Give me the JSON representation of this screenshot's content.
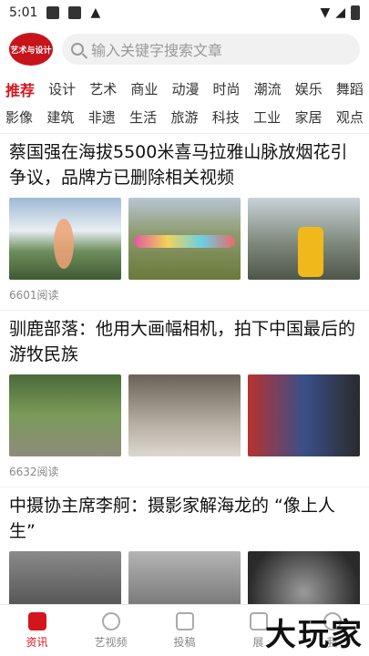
{
  "status": {
    "time": "5:01"
  },
  "header": {
    "logo_text": "艺术与设计",
    "search_placeholder": "输入关键字搜索文章"
  },
  "categories": {
    "row1": [
      "推荐",
      "设计",
      "艺术",
      "商业",
      "动漫",
      "时尚",
      "潮流",
      "娱乐",
      "舞蹈"
    ],
    "row2": [
      "影像",
      "建筑",
      "非遗",
      "生活",
      "旅游",
      "科技",
      "工业",
      "家居",
      "观点"
    ]
  },
  "articles": [
    {
      "title": "蔡国强在海拔5500米喜马拉雅山脉放烟花引争议，品牌方已删除相关视频",
      "reads": "6601阅读"
    },
    {
      "title": "驯鹿部落：他用大画幅相机，拍下中国最后的游牧民族",
      "reads": "6632阅读"
    },
    {
      "title": "中摄协主席李舸：摄影家解海龙的 “像上人生”",
      "reads": ""
    }
  ],
  "tabs": [
    "资讯",
    "艺视频",
    "投稿",
    "展",
    "我"
  ],
  "watermark": "大玩家",
  "colors": {
    "accent": "#d4161c"
  }
}
